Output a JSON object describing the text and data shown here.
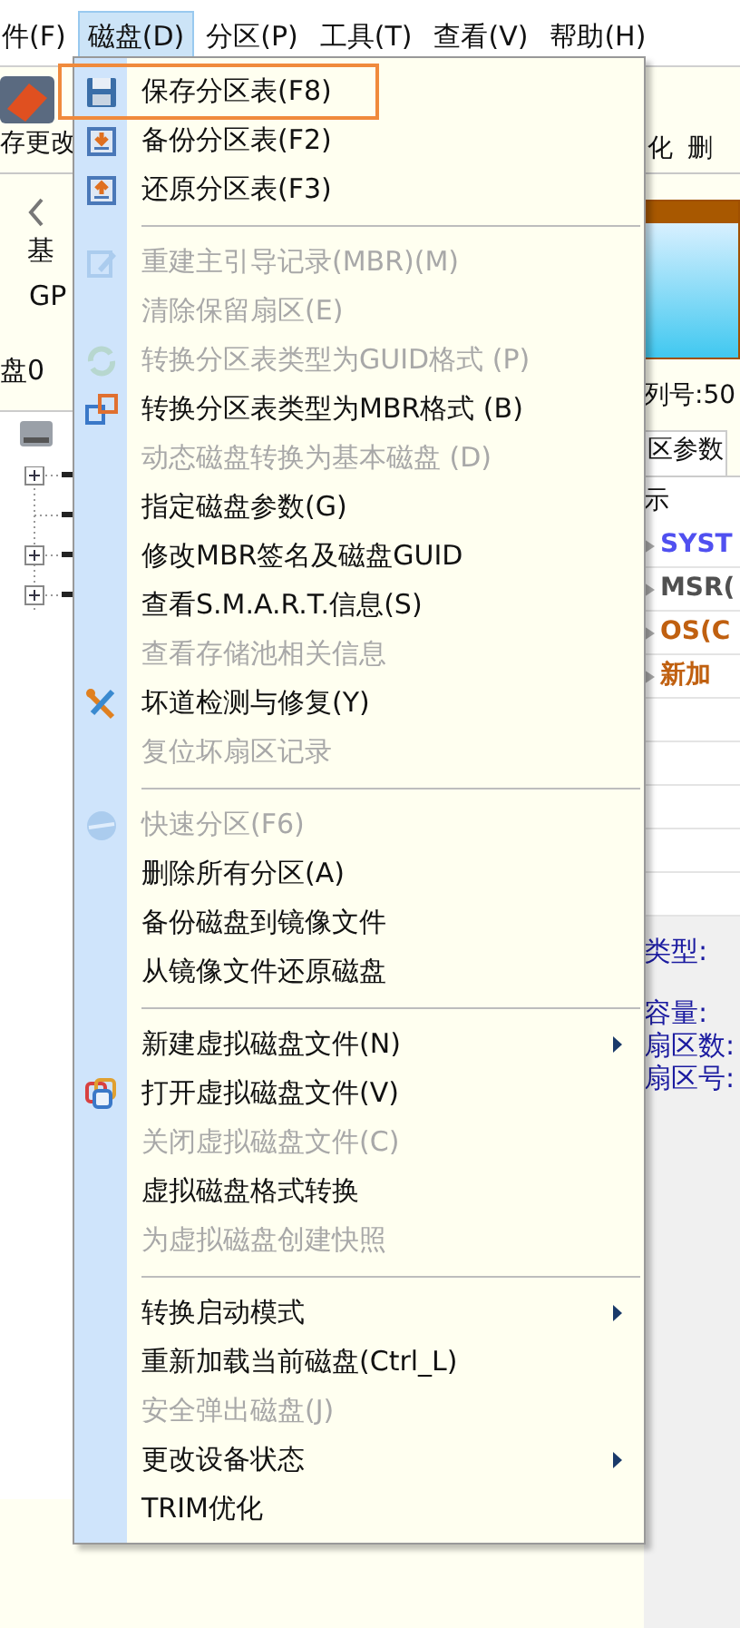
{
  "menubar": [
    {
      "label": "件(F)",
      "selected": false
    },
    {
      "label": "磁盘(D)",
      "selected": true
    },
    {
      "label": "分区(P)",
      "selected": false
    },
    {
      "label": "工具(T)",
      "selected": false
    },
    {
      "label": "查看(V)",
      "selected": false
    },
    {
      "label": "帮助(H)",
      "selected": false
    }
  ],
  "toolbar": {
    "left_label": "存更改",
    "right_labels": [
      "化",
      "删"
    ]
  },
  "disk_info": {
    "type": "基",
    "style": "GP",
    "disk_label": "盘0",
    "serial": "列号:50"
  },
  "tab": "区参数",
  "column_header": "示",
  "partitions": [
    {
      "name": "SYST",
      "color": "#5050f0"
    },
    {
      "name": "MSR(",
      "color": "#505050"
    },
    {
      "name": "OS(C",
      "color": "#c06010"
    },
    {
      "name": "新加",
      "color": "#c06010"
    }
  ],
  "details": [
    "类型:",
    "容量:",
    "扇区数:",
    "扇区号:"
  ],
  "menu": {
    "items": [
      {
        "kind": "item",
        "label": "保存分区表(F8)",
        "disabled": false,
        "highlighted": true,
        "submenu": false
      },
      {
        "kind": "item",
        "label": "备份分区表(F2)",
        "disabled": false,
        "highlighted": false,
        "submenu": false
      },
      {
        "kind": "item",
        "label": "还原分区表(F3)",
        "disabled": false,
        "highlighted": false,
        "submenu": false
      },
      {
        "kind": "separator"
      },
      {
        "kind": "item",
        "label": "重建主引导记录(MBR)(M)",
        "disabled": true,
        "highlighted": false,
        "submenu": false
      },
      {
        "kind": "item",
        "label": "清除保留扇区(E)",
        "disabled": true,
        "highlighted": false,
        "submenu": false
      },
      {
        "kind": "item",
        "label": "转换分区表类型为GUID格式 (P)",
        "disabled": true,
        "highlighted": false,
        "submenu": false
      },
      {
        "kind": "item",
        "label": "转换分区表类型为MBR格式 (B)",
        "disabled": false,
        "highlighted": false,
        "submenu": false
      },
      {
        "kind": "item",
        "label": "动态磁盘转换为基本磁盘 (D)",
        "disabled": true,
        "highlighted": false,
        "submenu": false
      },
      {
        "kind": "item",
        "label": "指定磁盘参数(G)",
        "disabled": false,
        "highlighted": false,
        "submenu": false
      },
      {
        "kind": "item",
        "label": "修改MBR签名及磁盘GUID",
        "disabled": false,
        "highlighted": false,
        "submenu": false
      },
      {
        "kind": "item",
        "label": "查看S.M.A.R.T.信息(S)",
        "disabled": false,
        "highlighted": false,
        "submenu": false
      },
      {
        "kind": "item",
        "label": "查看存储池相关信息",
        "disabled": true,
        "highlighted": false,
        "submenu": false
      },
      {
        "kind": "item",
        "label": "坏道检测与修复(Y)",
        "disabled": false,
        "highlighted": false,
        "submenu": false
      },
      {
        "kind": "item",
        "label": "复位坏扇区记录",
        "disabled": true,
        "highlighted": false,
        "submenu": false
      },
      {
        "kind": "separator"
      },
      {
        "kind": "item",
        "label": "快速分区(F6)",
        "disabled": true,
        "highlighted": false,
        "submenu": false
      },
      {
        "kind": "item",
        "label": "删除所有分区(A)",
        "disabled": false,
        "highlighted": false,
        "submenu": false
      },
      {
        "kind": "item",
        "label": "备份磁盘到镜像文件",
        "disabled": false,
        "highlighted": false,
        "submenu": false
      },
      {
        "kind": "item",
        "label": "从镜像文件还原磁盘",
        "disabled": false,
        "highlighted": false,
        "submenu": false
      },
      {
        "kind": "separator"
      },
      {
        "kind": "item",
        "label": "新建虚拟磁盘文件(N)",
        "disabled": false,
        "highlighted": false,
        "submenu": true
      },
      {
        "kind": "item",
        "label": "打开虚拟磁盘文件(V)",
        "disabled": false,
        "highlighted": false,
        "submenu": false
      },
      {
        "kind": "item",
        "label": "关闭虚拟磁盘文件(C)",
        "disabled": true,
        "highlighted": false,
        "submenu": false
      },
      {
        "kind": "item",
        "label": "虚拟磁盘格式转换",
        "disabled": false,
        "highlighted": false,
        "submenu": false
      },
      {
        "kind": "item",
        "label": "为虚拟磁盘创建快照",
        "disabled": true,
        "highlighted": false,
        "submenu": false
      },
      {
        "kind": "separator"
      },
      {
        "kind": "item",
        "label": "转换启动模式",
        "disabled": false,
        "highlighted": false,
        "submenu": true
      },
      {
        "kind": "item",
        "label": "重新加载当前磁盘(Ctrl_L)",
        "disabled": false,
        "highlighted": false,
        "submenu": false
      },
      {
        "kind": "item",
        "label": "安全弹出磁盘(J)",
        "disabled": true,
        "highlighted": false,
        "submenu": false
      },
      {
        "kind": "item",
        "label": "更改设备状态",
        "disabled": false,
        "highlighted": false,
        "submenu": true
      },
      {
        "kind": "item",
        "label": "TRIM优化",
        "disabled": false,
        "highlighted": false,
        "submenu": false
      }
    ]
  }
}
